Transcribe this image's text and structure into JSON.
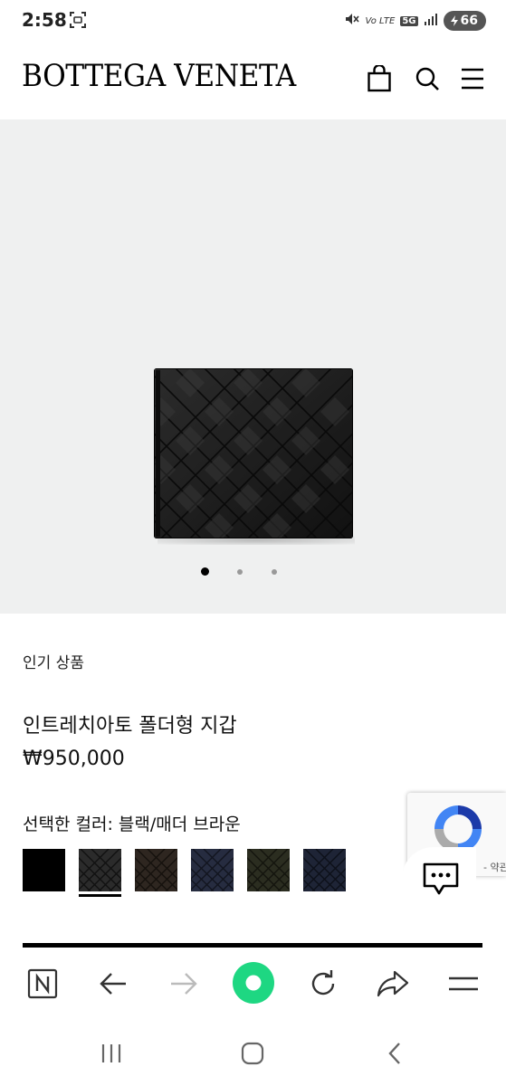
{
  "status_bar": {
    "time": "2:58",
    "network_label": "5G",
    "lte_label": "Vo LTE",
    "battery": "66"
  },
  "header": {
    "logo": "BOTTEGA VENETA",
    "icons": [
      "shopping-bag-icon",
      "search-icon",
      "menu-icon"
    ]
  },
  "gallery": {
    "image_count": 3,
    "active_index": 0
  },
  "product": {
    "category": "인기 상품",
    "name": "인트레치아토 폴더형 지갑",
    "price": "₩950,000",
    "color_label": "선택한 컬러: 블랙/매더 브라운",
    "swatches": [
      {
        "name": "solid-black",
        "color": "#000000",
        "selected": false
      },
      {
        "name": "black-weave",
        "color": "#2b2b2b",
        "selected": true
      },
      {
        "name": "brown-weave",
        "color": "#2e2620",
        "selected": false
      },
      {
        "name": "navy-weave",
        "color": "#262c40",
        "selected": false
      },
      {
        "name": "olive-weave",
        "color": "#2b2d20",
        "selected": false
      },
      {
        "name": "dark-navy-weave",
        "color": "#1e2436",
        "selected": false
      }
    ]
  },
  "recaptcha": {
    "text": "- 약관"
  },
  "browser_toolbar": {
    "icons": [
      "naver-n-icon",
      "back-arrow-icon",
      "forward-arrow-icon",
      "home-green-icon",
      "reload-icon",
      "share-icon",
      "menu-icon"
    ]
  },
  "nav_bar": {
    "icons": [
      "recents-icon",
      "home-icon",
      "back-icon"
    ]
  },
  "colors": {
    "gallery_bg": "#eff0f0",
    "accent_green": "#1ed782",
    "recaptcha_blue": "#1c3aa9"
  }
}
